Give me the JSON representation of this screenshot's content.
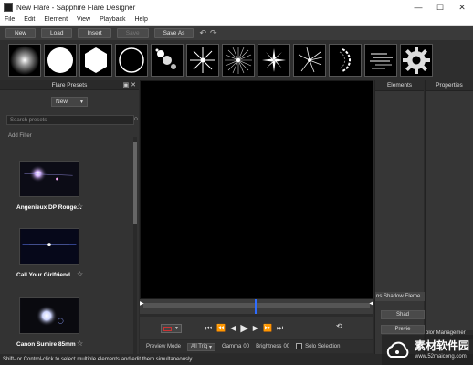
{
  "window": {
    "title": "New Flare - Sapphire Flare Designer",
    "controls": {
      "minimize": "—",
      "maximize": "☐",
      "close": "✕"
    }
  },
  "menu": [
    "File",
    "Edit",
    "Element",
    "View",
    "Playback",
    "Help"
  ],
  "toolbar": {
    "new": "New",
    "load": "Load",
    "insert": "Insert",
    "save": "Save",
    "save_as": "Save As",
    "undo": "↶",
    "redo": "↷"
  },
  "preset_tiles": [
    {
      "icon": "soft-glow-icon"
    },
    {
      "icon": "white-disc-icon"
    },
    {
      "icon": "hexagon-icon"
    },
    {
      "icon": "ring-icon"
    },
    {
      "icon": "dot-chain-icon"
    },
    {
      "icon": "streak-star-icon"
    },
    {
      "icon": "starburst-icon"
    },
    {
      "icon": "star-rays-icon"
    },
    {
      "icon": "spark-rays-icon"
    },
    {
      "icon": "arc-icon"
    },
    {
      "icon": "horizontal-streaks-icon"
    },
    {
      "icon": "gear-icon"
    }
  ],
  "flare_presets": {
    "header": "Flare Presets",
    "new_dropdown": "New",
    "search_placeholder": "Search presets",
    "add_filter": "Add Filter",
    "items": [
      {
        "name": "Angenieux DP Rouge...",
        "favorite": false
      },
      {
        "name": "Call Your Girlfriend",
        "favorite": false
      },
      {
        "name": "Canon Sumire 85mm",
        "favorite": false
      }
    ]
  },
  "transport": {
    "go_start": "⏮",
    "step_back": "⏪",
    "prev_frame": "◀",
    "play": "▶",
    "next_frame": "▶",
    "step_forward": "⏩",
    "go_end": "⏭",
    "loop": "⟲"
  },
  "status_row": {
    "preview_mode_label": "Preview Mode",
    "preview_mode_value": "All Trig",
    "gamma_label": "Gamma",
    "gamma_value": "00",
    "brightness_label": "Brightness",
    "brightness_value": "00",
    "solo_selection": "Solo Selection"
  },
  "elements_panel": {
    "header": "Elements",
    "shadow_element": "ns Shadow Eleme",
    "button1": "Shad",
    "button2": "Previe"
  },
  "properties_panel": {
    "header": "Properties",
    "color_management": "olor Managemer"
  },
  "statusbar": "Shift- or Control-click to select multiple elements and edit them simultaneously.",
  "watermark": {
    "cn": "素材软件园",
    "url": "www.52maicong.com"
  },
  "colors": {
    "playhead": "#2e6cff",
    "viewer_bg": "#000000",
    "panel_bg": "#333333"
  }
}
